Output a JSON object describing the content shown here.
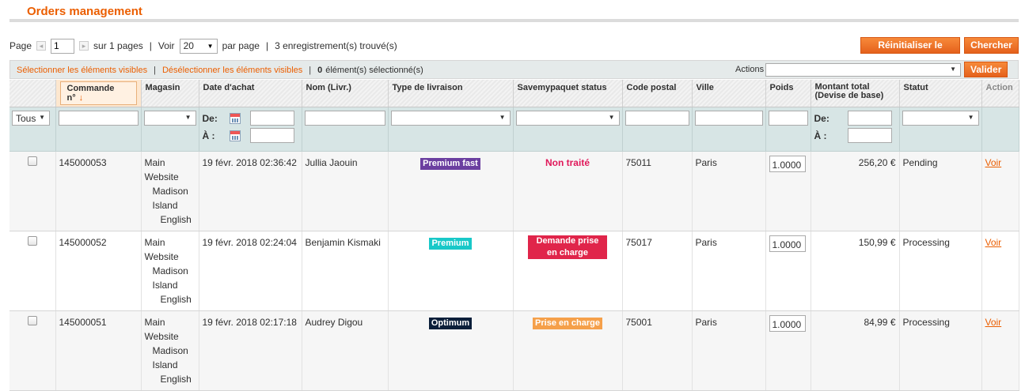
{
  "page": {
    "title": "Orders management"
  },
  "pager": {
    "page_label": "Page",
    "current_page": "1",
    "of_pages": "sur 1 pages",
    "view_label": "Voir",
    "per_page": "20",
    "per_page_label": "par page",
    "records_found": "3 enregistrement(s) trouvé(s)"
  },
  "buttons": {
    "reset_filter": "Réinitialiser le filtre",
    "search": "Chercher",
    "submit": "Valider"
  },
  "massaction": {
    "select_visible": "Sélectionner les éléments visibles",
    "unselect_visible": "Désélectionner les éléments visibles",
    "selected_count": "0",
    "selected_label": "élément(s) sélectionné(s)",
    "actions_label": "Actions",
    "actions_value": ""
  },
  "columns": [
    {
      "label": ""
    },
    {
      "label": "Commande n°"
    },
    {
      "label": "Magasin"
    },
    {
      "label": "Date d'achat"
    },
    {
      "label": "Nom (Livr.)"
    },
    {
      "label": "Type de livraison"
    },
    {
      "label": "Savemypaquet status"
    },
    {
      "label": "Code postal"
    },
    {
      "label": "Ville"
    },
    {
      "label": "Poids"
    },
    {
      "label": "Montant total (Devise de base)"
    },
    {
      "label": "Statut"
    },
    {
      "label": "Action"
    }
  ],
  "filters": {
    "select_all": "Tous",
    "from_label": "De:",
    "to_label": "À :"
  },
  "rows": [
    {
      "order": "145000053",
      "store": [
        "Main",
        "Website",
        "Madison",
        "Island",
        "English"
      ],
      "date": "19 févr. 2018 02:36:42",
      "name": "Jullia Jaouin",
      "delivery": "Premium fast",
      "delivery_color": "#6b3fa0",
      "sm_status": "Non traité",
      "sm_status_style": "text",
      "sm_status_color": "#e0185a",
      "postcode": "75011",
      "city": "Paris",
      "weight": "1.0000",
      "total": "256,20 €",
      "status": "Pending",
      "action": "Voir"
    },
    {
      "order": "145000052",
      "store": [
        "Main",
        "Website",
        "Madison",
        "Island",
        "English"
      ],
      "date": "19 févr. 2018 02:24:04",
      "name": "Benjamin Kismaki",
      "delivery": "Premium",
      "delivery_color": "#19c8c8",
      "sm_status": "Demande prise en charge",
      "sm_status_style": "badge",
      "sm_status_color": "#e0254a",
      "postcode": "75017",
      "city": "Paris",
      "weight": "1.0000",
      "total": "150,99 €",
      "status": "Processing",
      "action": "Voir"
    },
    {
      "order": "145000051",
      "store": [
        "Main",
        "Website",
        "Madison",
        "Island",
        "English"
      ],
      "date": "19 févr. 2018 02:17:18",
      "name": "Audrey Digou",
      "delivery": "Optimum",
      "delivery_color": "#0b1f3a",
      "sm_status": "Prise en charge",
      "sm_status_style": "badge",
      "sm_status_color": "#f5a04a",
      "postcode": "75001",
      "city": "Paris",
      "weight": "1.0000",
      "total": "84,99 €",
      "status": "Processing",
      "action": "Voir"
    }
  ],
  "colors": {
    "accent": "#eb5e00",
    "filter_bg": "#d7e5e5",
    "massbar_bg": "#e5eaea"
  }
}
